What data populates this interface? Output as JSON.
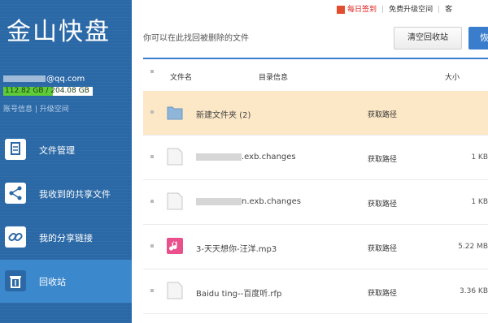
{
  "app": {
    "logo": "金山快盘"
  },
  "account": {
    "email_suffix": "@qq.com",
    "quota_text": "112.82 GB / 204.08 GB",
    "quota_fraction": 0.553,
    "account_info": "账号信息",
    "upgrade_space": "升级空间"
  },
  "nav": [
    {
      "label": "文件管理",
      "icon": "file-manage-icon",
      "active": false
    },
    {
      "label": "我收到的共享文件",
      "icon": "share-icon",
      "active": false
    },
    {
      "label": "我的分享链接",
      "icon": "link-icon",
      "active": false
    },
    {
      "label": "回收站",
      "icon": "trash-icon",
      "active": true
    }
  ],
  "topbar": {
    "daily_checkin": "每日签到",
    "free_upgrade": "免费升级空间",
    "more": "客"
  },
  "toolbar": {
    "hint": "你可以在此找回被删除的文件",
    "clear_label": "清空回收站",
    "restore_label": "恢"
  },
  "table": {
    "headers": {
      "name": "文件名",
      "path": "目录信息",
      "size": "大小"
    },
    "rows": [
      {
        "name": "新建文件夹 (2)",
        "path": "获取路径",
        "size": "",
        "type": "folder",
        "selected": true
      },
      {
        "name": ".exb.changes",
        "path": "获取路径",
        "size": "1 KB",
        "type": "file",
        "blurred": true
      },
      {
        "name": "n.exb.changes",
        "path": "获取路径",
        "size": "1 KB",
        "type": "file",
        "blurred": true
      },
      {
        "name": "3-天天想你-汪洋.mp3",
        "path": "获取路径",
        "size": "5.22 MB",
        "type": "music"
      },
      {
        "name": "Baidu ting--百度听.rfp",
        "path": "获取路径",
        "size": "3.36 KB",
        "type": "file"
      }
    ]
  },
  "colors": {
    "sidebar": "#2a68a6",
    "active_nav": "#3b88cc",
    "accent": "#3a7dcc",
    "selected_row": "#fce7c6",
    "quota_fill": "#5ecb38"
  }
}
